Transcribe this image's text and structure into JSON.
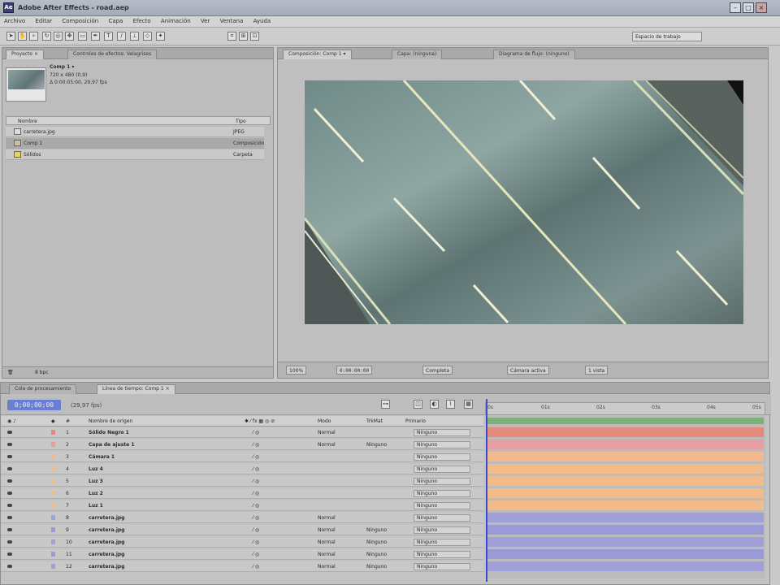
{
  "window": {
    "title": "Adobe After Effects - road.aep",
    "app_icon_label": "Ae"
  },
  "menu": [
    "Archivo",
    "Editar",
    "Composición",
    "Capa",
    "Efecto",
    "Animación",
    "Ver",
    "Ventana",
    "Ayuda"
  ],
  "workspace": "Espacio de trabajo",
  "project_panel": {
    "tabs": [
      "Proyecto ×",
      "Controles de efectos: Velagrises"
    ],
    "selected_name": "Comp 1 ▾",
    "selected_info": [
      "720 x 480 (0,9)",
      "Δ 0:00:05:00, 29,97 fps"
    ],
    "columns": {
      "name": "Nombre",
      "type": "Tipo"
    },
    "items": [
      {
        "name": "carretera.jpg",
        "type": "JPEG"
      },
      {
        "name": "Comp 1",
        "type": "Composición"
      },
      {
        "name": "Sólidos",
        "type": "Carpeta"
      }
    ],
    "footer": "8 bpc"
  },
  "comp_panel": {
    "tabs": [
      "Composición: Comp 1 ▾",
      "Capa: (ninguna)",
      "Diagrama de flujo: (ninguno)"
    ],
    "zoom": "100%",
    "timecode": "0:00:00:00",
    "resolution": "Completa",
    "camera": "Cámara activa",
    "views": "1 vista"
  },
  "timeline": {
    "tabs": [
      "Cola de procesamiento",
      "Línea de tiempo: Comp 1 ×"
    ],
    "timecode": "0;00;00;00",
    "frames": "(29,97 fps)",
    "columns": {
      "name": "Nombre de origen",
      "mode": "Modo",
      "track": "TrkMat",
      "parent": "Primario"
    },
    "ruler": [
      "0s",
      "01s",
      "02s",
      "03s",
      "04s",
      "05s"
    ],
    "layers": [
      {
        "num": "1",
        "name": "Sólido Negro 1",
        "mode": "Normal",
        "track": "",
        "parent": "Ninguno",
        "color": "#e6897d"
      },
      {
        "num": "2",
        "name": "Capa de ajuste 1",
        "mode": "Normal",
        "track": "Ninguno",
        "parent": "Ninguno",
        "color": "#e69ea0"
      },
      {
        "num": "3",
        "name": "Cámara 1",
        "mode": "",
        "track": "",
        "parent": "Ninguno",
        "color": "#f2b98e"
      },
      {
        "num": "4",
        "name": "Luz 4",
        "mode": "",
        "track": "",
        "parent": "Ninguno",
        "color": "#f2bb8a"
      },
      {
        "num": "5",
        "name": "Luz 3",
        "mode": "",
        "track": "",
        "parent": "Ninguno",
        "color": "#f2bb8a"
      },
      {
        "num": "6",
        "name": "Luz 2",
        "mode": "",
        "track": "",
        "parent": "Ninguno",
        "color": "#f2bb8a"
      },
      {
        "num": "7",
        "name": "Luz 1",
        "mode": "",
        "track": "",
        "parent": "Ninguno",
        "color": "#f2bb8a"
      },
      {
        "num": "8",
        "name": "carretera.jpg",
        "mode": "Normal",
        "track": "",
        "parent": "Ninguno",
        "color": "#a09fd8"
      },
      {
        "num": "9",
        "name": "carretera.jpg",
        "mode": "Normal",
        "track": "Ninguno",
        "parent": "Ninguno",
        "color": "#9a9ad6"
      },
      {
        "num": "10",
        "name": "carretera.jpg",
        "mode": "Normal",
        "track": "Ninguno",
        "parent": "Ninguno",
        "color": "#a09fd8"
      },
      {
        "num": "11",
        "name": "carretera.jpg",
        "mode": "Normal",
        "track": "Ninguno",
        "parent": "Ninguno",
        "color": "#9a9ad6"
      },
      {
        "num": "12",
        "name": "carretera.jpg",
        "mode": "Normal",
        "track": "Ninguno",
        "parent": "Ninguno",
        "color": "#a09fd8"
      }
    ],
    "work_area_color": "#7fb07a"
  }
}
